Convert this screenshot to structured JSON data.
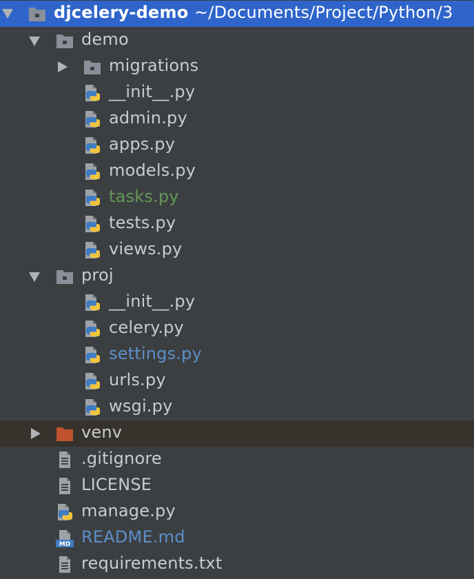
{
  "root": {
    "name": "djcelery-demo",
    "path": "~/Documents/Project/Python/3"
  },
  "demo": {
    "name": "demo",
    "migrations": "migrations",
    "files": [
      "__init__.py",
      "admin.py",
      "apps.py",
      "models.py",
      "tasks.py",
      "tests.py",
      "views.py"
    ]
  },
  "proj": {
    "name": "proj",
    "files": [
      "__init__.py",
      "celery.py",
      "settings.py",
      "urls.py",
      "wsgi.py"
    ]
  },
  "venv": "venv",
  "root_files": [
    ".gitignore",
    "LICENSE",
    "manage.py",
    "README.md",
    "requirements.txt"
  ],
  "icons": {
    "folder": "folder-icon",
    "module_folder": "module-folder-icon",
    "excluded_folder": "excluded-folder-icon",
    "python_file": "python-file-icon",
    "text_file": "text-file-icon",
    "markdown_file": "markdown-file-icon"
  },
  "colors": {
    "background": "#3c3f41",
    "selection": "#2f65ca",
    "highlight_row": "#36332d",
    "text": "#c8cbcf",
    "modified_new": "#629755",
    "modified": "#5c8fc9",
    "excluded_folder": "#c0532d"
  }
}
